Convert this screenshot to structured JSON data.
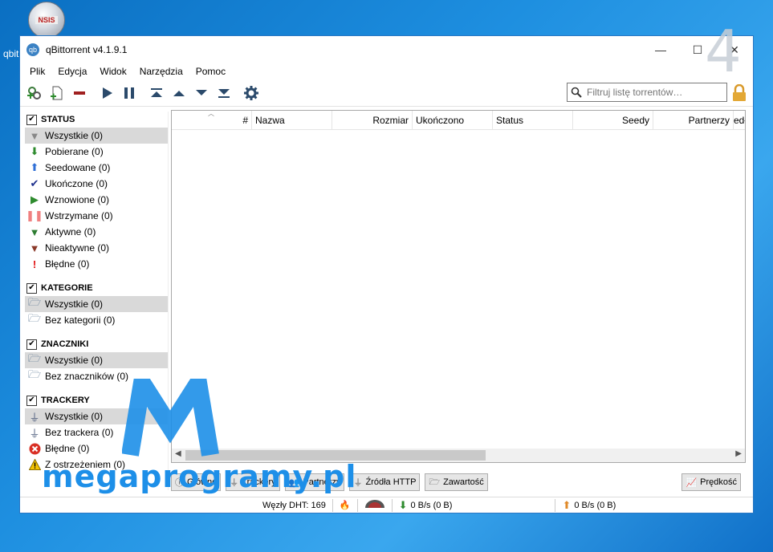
{
  "desktop": {
    "icon_badge": "NSIS",
    "label": "qbit",
    "step_number": "4"
  },
  "window": {
    "title": "qBittorrent v4.1.9.1",
    "minimize": "—",
    "maximize": "☐",
    "close": "✕"
  },
  "menu": [
    "Plik",
    "Edycja",
    "Widok",
    "Narzędzia",
    "Pomoc"
  ],
  "toolbar": {
    "search_placeholder": "Filtruj listę torrentów…"
  },
  "sidebar": {
    "status": {
      "title": "STATUS",
      "items": [
        {
          "label": "Wszystkie (0)",
          "icon": "filter-icon",
          "color": "#888888"
        },
        {
          "label": "Pobierane (0)",
          "icon": "download-arrow-icon",
          "color": "#2e8b2e"
        },
        {
          "label": "Seedowane (0)",
          "icon": "upload-arrow-icon",
          "color": "#2f6fd6"
        },
        {
          "label": "Ukończone (0)",
          "icon": "checkmark-icon",
          "color": "#1d2f8c"
        },
        {
          "label": "Wznowione (0)",
          "icon": "play-icon",
          "color": "#2e8b2e"
        },
        {
          "label": "Wstrzymane (0)",
          "icon": "pause-icon",
          "color": "#f08080"
        },
        {
          "label": "Aktywne (0)",
          "icon": "filter-active-icon",
          "color": "#2e7d32"
        },
        {
          "label": "Nieaktywne (0)",
          "icon": "filter-inactive-icon",
          "color": "#8b3a2a"
        },
        {
          "label": "Błędne (0)",
          "icon": "exclamation-icon",
          "color": "#e01010"
        }
      ]
    },
    "categories": {
      "title": "KATEGORIE",
      "items": [
        "Wszystkie (0)",
        "Bez kategorii (0)"
      ]
    },
    "tags": {
      "title": "ZNACZNIKI",
      "items": [
        "Wszystkie (0)",
        "Bez znaczników (0)"
      ]
    },
    "trackers": {
      "title": "TRACKERY",
      "items": [
        "Wszystkie (0)",
        "Bez trackera (0)",
        "Błędne (0)",
        "Z ostrzeżeniem (0)"
      ]
    }
  },
  "table": {
    "columns": [
      "#",
      "Nazwa",
      "Rozmiar",
      "Ukończono",
      "Status",
      "Seedy",
      "Partnerzy",
      "edł"
    ]
  },
  "bottom_tabs": [
    "Główne",
    "Trackery",
    "Partnerzy",
    "Źródła HTTP",
    "Zawartość",
    "Prędkość"
  ],
  "statusbar": {
    "dht": "Węzły DHT: 169",
    "download": "0 B/s (0 B)",
    "upload": "0 B/s (0 B)"
  },
  "watermark": {
    "text": "megaprogramy.pl"
  }
}
